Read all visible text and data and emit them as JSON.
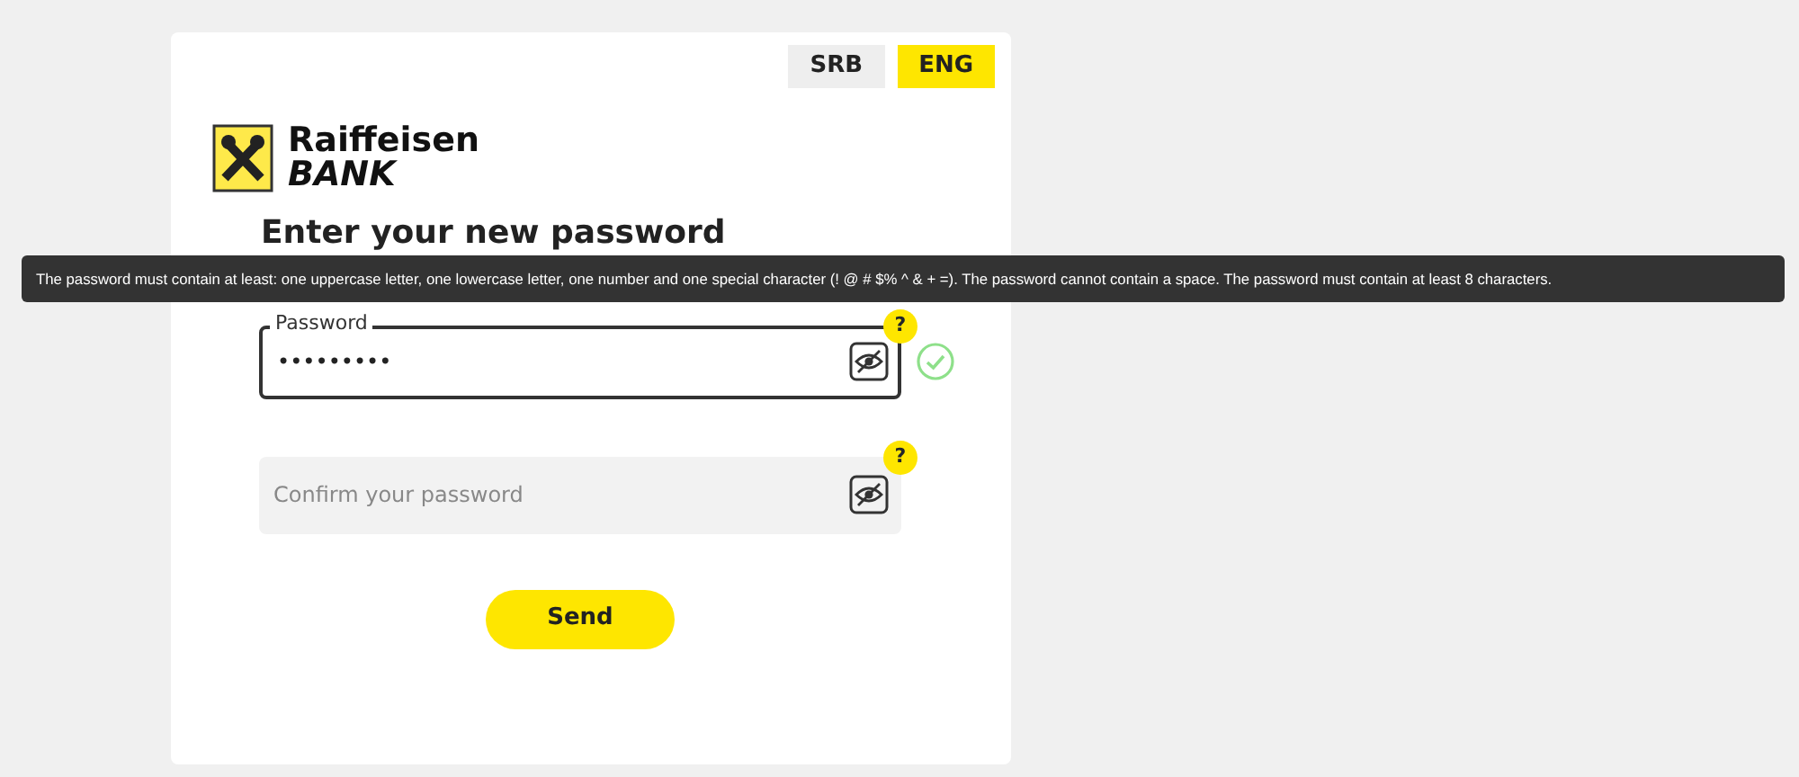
{
  "languages": [
    {
      "label": "SRB",
      "selected": false
    },
    {
      "label": "ENG",
      "selected": true
    }
  ],
  "logo": {
    "line1": "Raiffeisen",
    "line2": "BANK"
  },
  "heading": "Enter your new password",
  "tooltip": "The password must contain at least: one uppercase letter, one lowercase letter, one number and one special character (! @ # $% ^ & + =). The password cannot contain a space. The password must contain at least 8 characters.",
  "fields": [
    {
      "label": "Password",
      "value": "•••••••••",
      "focused": true,
      "valid": true,
      "help": "?"
    },
    {
      "placeholder": "Confirm your password",
      "focused": false,
      "help": "?"
    }
  ],
  "submit": "Send"
}
